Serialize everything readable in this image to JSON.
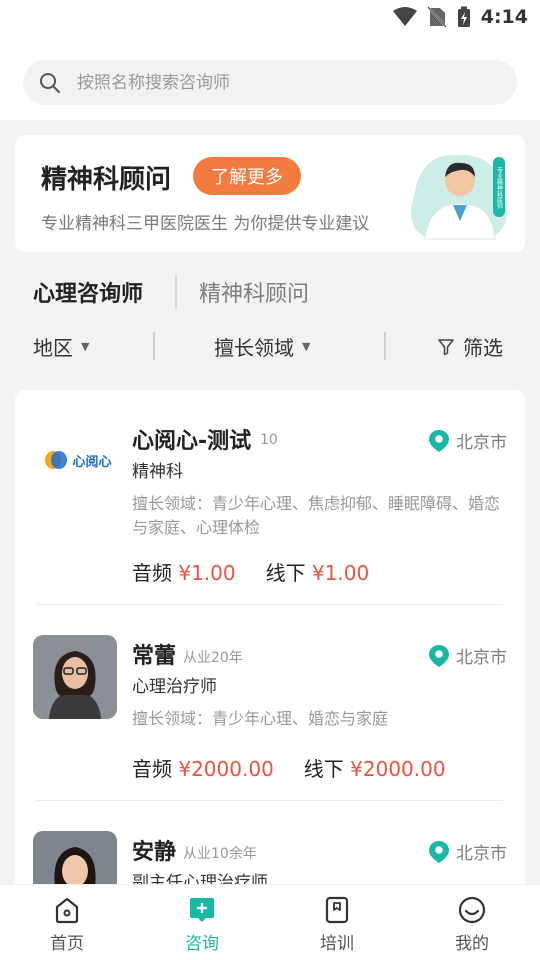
{
  "status": {
    "time": "4:14"
  },
  "search": {
    "placeholder": "按照名称搜索咨询师"
  },
  "banner": {
    "title": "精神科顾问",
    "button": "了解更多",
    "subtitle": "专业精神科三甲医院医生 为你提供专业建议",
    "badge_text": "专业精神科医师"
  },
  "tabs": [
    {
      "label": "心理咨询师"
    },
    {
      "label": "精神科顾问"
    }
  ],
  "filters": {
    "region": "地区",
    "field": "擅长领域",
    "filter": "筛选"
  },
  "counselors": [
    {
      "logo_text": "心阅心",
      "name": "心阅心-测试",
      "years": "10",
      "title": "精神科",
      "location": "北京市",
      "specialty": "擅长领域：青少年心理、焦虑抑郁、睡眠障碍、婚恋与家庭、心理体检",
      "audio_label": "音频",
      "audio_price": "¥1.00",
      "offline_label": "线下",
      "offline_price": "¥1.00"
    },
    {
      "name": "常蕾",
      "years": "从业20年",
      "title": "心理治疗师",
      "location": "北京市",
      "specialty": "擅长领域：青少年心理、婚恋与家庭",
      "audio_label": "音频",
      "audio_price": "¥2000.00",
      "offline_label": "线下",
      "offline_price": "¥2000.00"
    },
    {
      "name": "安静",
      "years": "从业10余年",
      "title": "副主任心理治疗师",
      "location": "北京市"
    }
  ],
  "nav": [
    {
      "label": "首页",
      "icon": "home-icon"
    },
    {
      "label": "咨询",
      "icon": "consult-icon"
    },
    {
      "label": "培训",
      "icon": "training-icon"
    },
    {
      "label": "我的",
      "icon": "profile-icon"
    }
  ],
  "colors": {
    "accent": "#19b8a6",
    "orange": "#f47b3f",
    "price": "#f0523e"
  }
}
